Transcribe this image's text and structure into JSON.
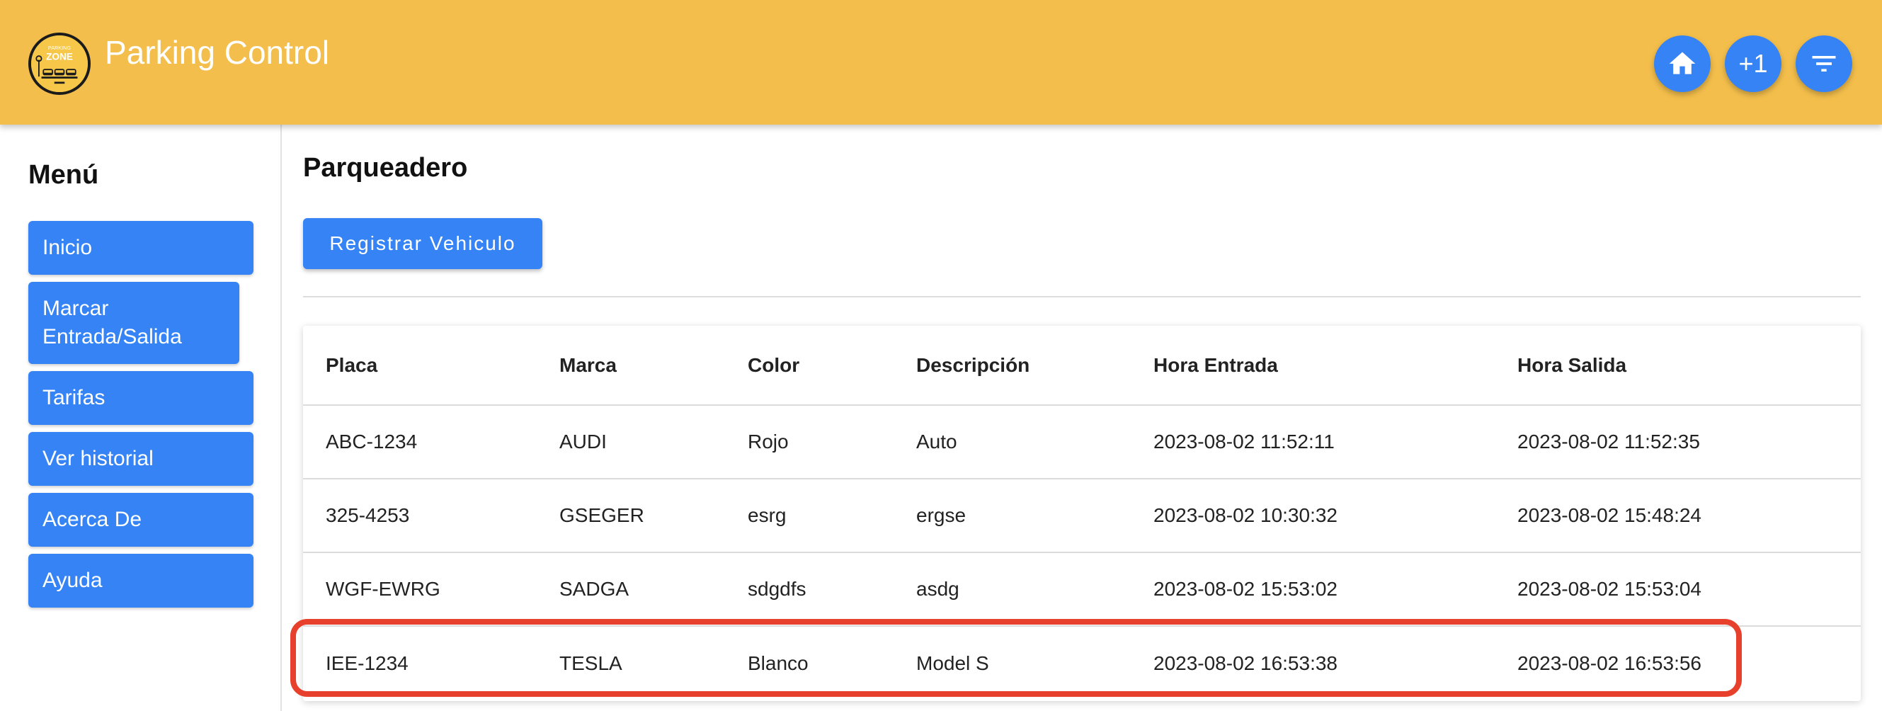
{
  "header": {
    "logo_text_top": "PARKING",
    "logo_text_main": "ZONE",
    "title": "Parking Control",
    "plus_label": "+1",
    "colors": {
      "background": "#f3be4b",
      "button": "#3583f5"
    },
    "buttons": [
      {
        "icon": "home-icon"
      },
      {
        "icon": "plus-one-icon"
      },
      {
        "icon": "filter-icon"
      }
    ]
  },
  "sidebar": {
    "title": "Menú",
    "items": [
      {
        "label": "Inicio"
      },
      {
        "label": "Marcar Entrada/Salida"
      },
      {
        "label": "Tarifas"
      },
      {
        "label": "Ver historial"
      },
      {
        "label": "Acerca De"
      },
      {
        "label": "Ayuda"
      }
    ]
  },
  "main": {
    "title": "Parqueadero",
    "register_label": "Registrar Vehiculo",
    "table": {
      "headers": [
        "Placa",
        "Marca",
        "Color",
        "Descripción",
        "Hora Entrada",
        "Hora Salida"
      ],
      "rows": [
        [
          "ABC-1234",
          "AUDI",
          "Rojo",
          "Auto",
          "2023-08-02 11:52:11",
          "2023-08-02 11:52:35"
        ],
        [
          "325-4253",
          "GSEGER",
          "esrg",
          "ergse",
          "2023-08-02 10:30:32",
          "2023-08-02 15:48:24"
        ],
        [
          "WGF-EWRG",
          "SADGA",
          "sdgdfs",
          "asdg",
          "2023-08-02 15:53:02",
          "2023-08-02 15:53:04"
        ],
        [
          "IEE-1234",
          "TESLA",
          "Blanco",
          "Model S",
          "2023-08-02 16:53:38",
          "2023-08-02 16:53:56"
        ]
      ]
    },
    "highlight_color": "#e7402c"
  }
}
